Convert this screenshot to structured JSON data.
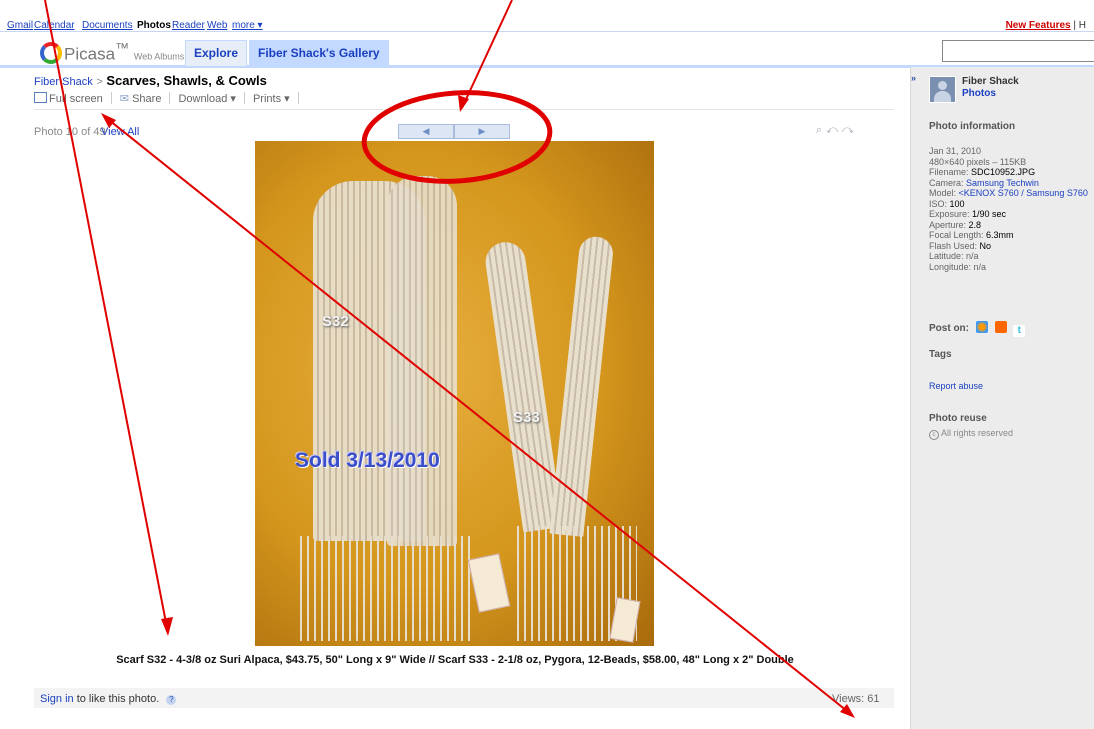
{
  "gbar": {
    "items": [
      "Gmail",
      "Calendar",
      "Documents",
      "Photos",
      "Reader",
      "Web",
      "more ▾"
    ],
    "current": "Photos",
    "new_features": "New Features",
    "after": "| H"
  },
  "header": {
    "logo": "Picasa",
    "logo_sub": "Web Albums",
    "tabs": [
      "Explore",
      "Fiber Shack's Gallery"
    ]
  },
  "breadcrumb": {
    "parent": "Fiber Shack",
    "sep": ">",
    "title": "Scarves, Shawls, & Cowls"
  },
  "toolbar": {
    "fullscreen": "Full screen",
    "share": "Share",
    "download": "Download",
    "prints": "Prints"
  },
  "photo_count": "Photo 10 of 49",
  "view_all": "View All",
  "photo": {
    "labels": {
      "s32": "S32",
      "s33": "S33",
      "sold": "Sold 3/13/2010"
    }
  },
  "caption": "Scarf S32 - 4-3/8 oz Suri Alpaca, $43.75, 50\" Long x 9\" Wide // Scarf S33 - 2-1/8 oz, Pygora, 12-Beads, $58.00, 48\" Long x 2\" Double",
  "bottom": {
    "sign_in": "Sign in",
    "like_text": "to like this photo.",
    "views": "Views: 61"
  },
  "sidebar": {
    "owner": "Fiber Shack",
    "owner_link": "Photos",
    "info_heading": "Photo information",
    "info": [
      {
        "label": "",
        "value": "Jan 31, 2010"
      },
      {
        "label": "",
        "value": "480×640 pixels – 115KB"
      },
      {
        "label": "Filename: ",
        "value": "SDC10952.JPG"
      },
      {
        "label": "Camera: ",
        "value": "Samsung Techwin"
      },
      {
        "label": "Model: ",
        "value": "<KENOX S760 / Samsung S760"
      },
      {
        "label": "ISO: ",
        "value": "100"
      },
      {
        "label": "Exposure: ",
        "value": "1/90 sec"
      },
      {
        "label": "Aperture: ",
        "value": "2.8"
      },
      {
        "label": "Focal Length: ",
        "value": "6.3mm"
      },
      {
        "label": "Flash Used: ",
        "value": "No"
      },
      {
        "label": "Latitude: ",
        "value": "n/a"
      },
      {
        "label": "Longitude: ",
        "value": "n/a"
      }
    ],
    "post_on": "Post on:",
    "tags": "Tags",
    "report": "Report abuse",
    "reuse_heading": "Photo reuse",
    "rights": "All rights reserved"
  },
  "colors": {
    "link": "#1a3fc0",
    "annotation": "#e00000",
    "new_features": "#cc0000"
  }
}
